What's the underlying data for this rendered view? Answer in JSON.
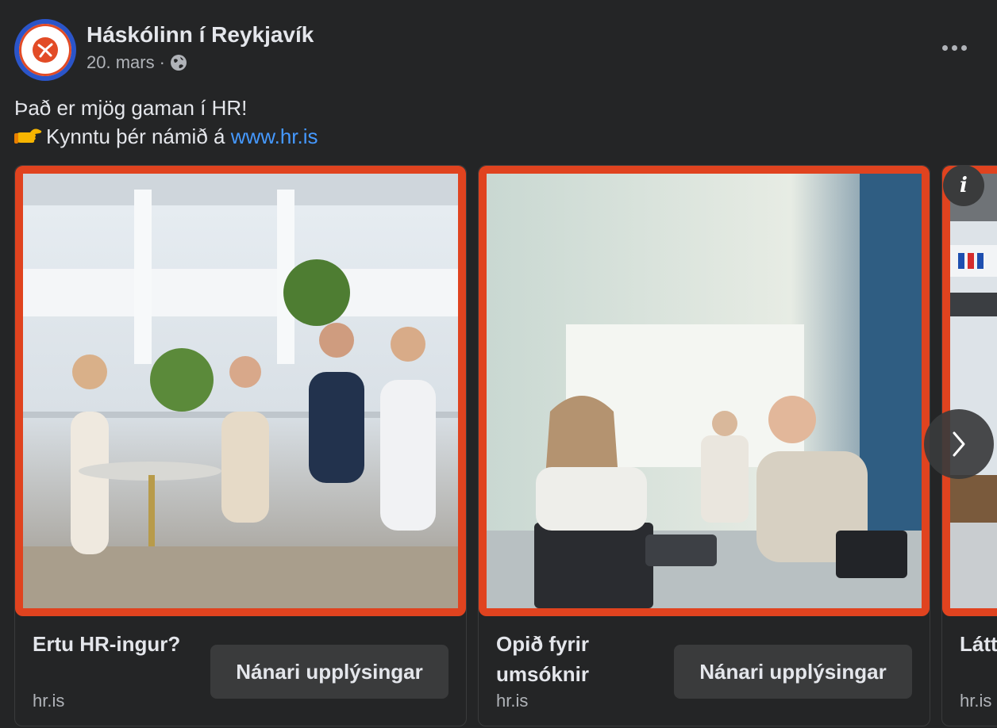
{
  "post": {
    "page_name": "Háskólinn í Reykjavík",
    "date": "20. mars",
    "separator": "·",
    "privacy_icon": "globe-icon",
    "more_icon": "more-options-icon",
    "text_line1": "Það er mjög gaman í HR!",
    "text_line2_prefix": "Kynntu þér námið á ",
    "text_link": "www.hr.is",
    "emoji_icon": "pointing-hand-icon"
  },
  "carousel": {
    "cards": [
      {
        "title": "Ertu HR-ingur?",
        "domain": "hr.is",
        "cta": "Nánari upplýsingar"
      },
      {
        "title": "Opið fyrir umsóknir",
        "domain": "hr.is",
        "cta": "Nánari upplýsingar"
      },
      {
        "title": "Látt rætt",
        "domain": "hr.is",
        "cta": ""
      }
    ],
    "info_label": "i",
    "next_icon": "chevron-right-icon"
  },
  "colors": {
    "background": "#242526",
    "card_border_accent": "#e0431f",
    "link": "#4599ff",
    "text_primary": "#e4e6eb",
    "text_secondary": "#b0b3b8",
    "button_bg": "#3a3b3c"
  }
}
